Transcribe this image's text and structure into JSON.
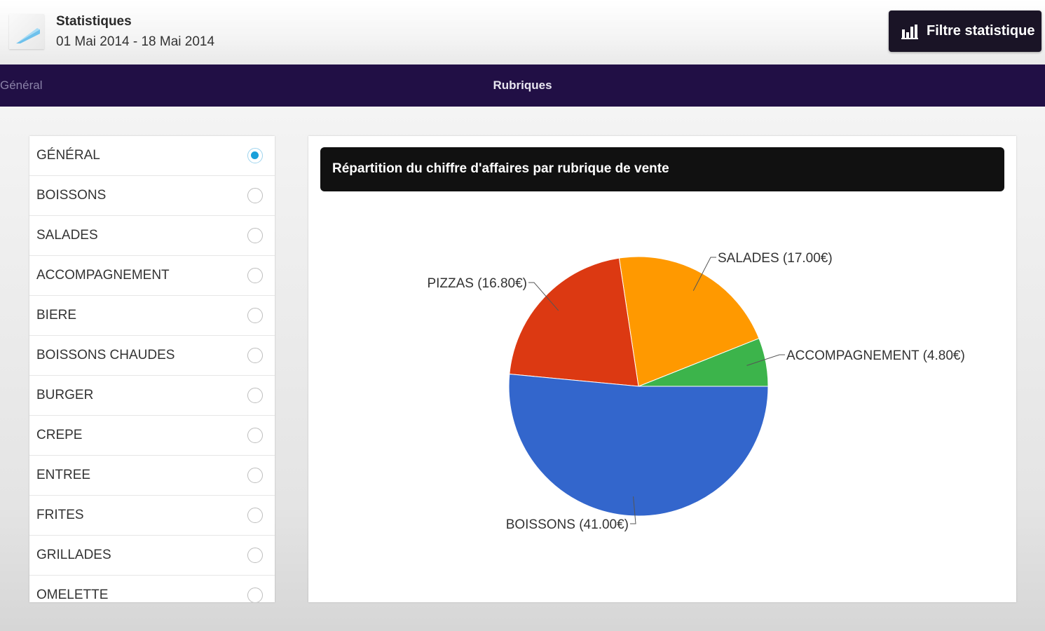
{
  "header": {
    "title": "Statistiques",
    "date_range": "01 Mai 2014 - 18 Mai 2014",
    "filter_button": "Filtre statistique"
  },
  "tabs": {
    "general": "Général",
    "rubriques": "Rubriques"
  },
  "list": {
    "items": [
      {
        "label": "GÉNÉRAL",
        "selected": true
      },
      {
        "label": "BOISSONS",
        "selected": false
      },
      {
        "label": "SALADES",
        "selected": false
      },
      {
        "label": "ACCOMPAGNEMENT",
        "selected": false
      },
      {
        "label": "BIERE",
        "selected": false
      },
      {
        "label": "BOISSONS CHAUDES",
        "selected": false
      },
      {
        "label": "BURGER",
        "selected": false
      },
      {
        "label": "CREPE",
        "selected": false
      },
      {
        "label": "ENTREE",
        "selected": false
      },
      {
        "label": "FRITES",
        "selected": false
      },
      {
        "label": "GRILLADES",
        "selected": false
      },
      {
        "label": "OMELETTE",
        "selected": false
      }
    ]
  },
  "chart_panel": {
    "header": "Répartition du chiffre d'affaires par rubrique de vente"
  },
  "chart_data": {
    "type": "pie",
    "title": "Répartition du chiffre d'affaires par rubrique de vente",
    "slices": [
      {
        "name": "ACCOMPAGNEMENT",
        "value": 4.8,
        "label": "ACCOMPAGNEMENT (4.80€)",
        "color": "#3cb44b"
      },
      {
        "name": "SALADES",
        "value": 17.0,
        "label": "SALADES (17.00€)",
        "color": "#ff9900"
      },
      {
        "name": "PIZZAS",
        "value": 16.8,
        "label": "PIZZAS (16.80€)",
        "color": "#dc3912"
      },
      {
        "name": "BOISSONS",
        "value": 41.0,
        "label": "BOISSONS (41.00€)",
        "color": "#3366cc"
      }
    ]
  },
  "colors": {
    "tabbar": "#210f45",
    "button": "#1a1426",
    "radio_selected": "#1aa0da"
  }
}
